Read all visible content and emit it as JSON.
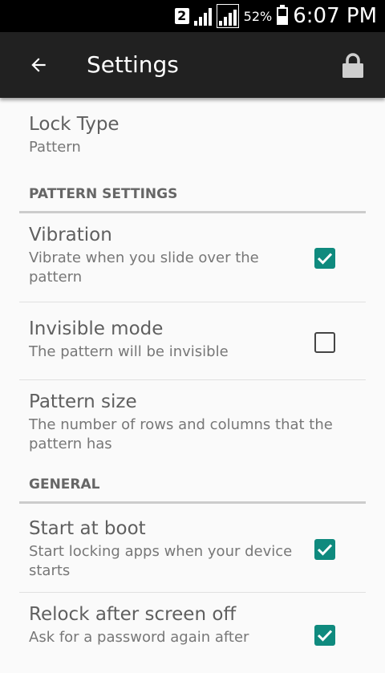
{
  "status_bar": {
    "sim_slot": "2",
    "battery_percent": "52%",
    "time": "6:07 PM",
    "battery_level": 0.52
  },
  "app_bar": {
    "title": "Settings",
    "back_icon": "arrow-back-icon",
    "action_icon": "lock-icon"
  },
  "lock_type": {
    "title": "Lock Type",
    "summary": "Pattern"
  },
  "pattern_settings": {
    "header": "PATTERN SETTINGS",
    "vibration": {
      "title": "Vibration",
      "summary": "Vibrate when you slide over the pattern",
      "checked": true
    },
    "invisible_mode": {
      "title": "Invisible mode",
      "summary": "The pattern will be invisible",
      "checked": false
    },
    "pattern_size": {
      "title": "Pattern size",
      "summary": "The number of rows and columns that the pattern has"
    }
  },
  "general": {
    "header": "GENERAL",
    "start_at_boot": {
      "title": "Start at boot",
      "summary": "Start locking apps when your device starts",
      "checked": true
    },
    "relock": {
      "title": "Relock after screen off",
      "summary": "Ask for a password again after",
      "checked": true
    }
  },
  "colors": {
    "accent": "#0f8a7e",
    "app_bar": "#212121",
    "status_bar": "#000000",
    "background": "#fafafa"
  }
}
